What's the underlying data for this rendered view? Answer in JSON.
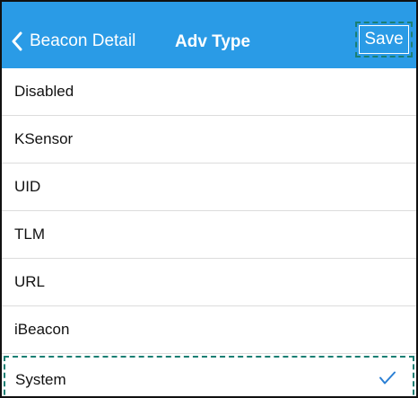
{
  "navbar": {
    "back_label": "Beacon Detail",
    "title": "Adv Type",
    "save_label": "Save",
    "background_color": "#2a9be6"
  },
  "adv_types": [
    {
      "label": "Disabled",
      "selected": false
    },
    {
      "label": "KSensor",
      "selected": false
    },
    {
      "label": "UID",
      "selected": false
    },
    {
      "label": "TLM",
      "selected": false
    },
    {
      "label": "URL",
      "selected": false
    },
    {
      "label": "iBeacon",
      "selected": false
    },
    {
      "label": "System",
      "selected": true
    }
  ],
  "icons": {
    "back": "chevron-left-icon",
    "selected": "checkmark-icon"
  },
  "colors": {
    "checkmark": "#2a7fd4",
    "highlight_dash": "#1a7f73"
  }
}
